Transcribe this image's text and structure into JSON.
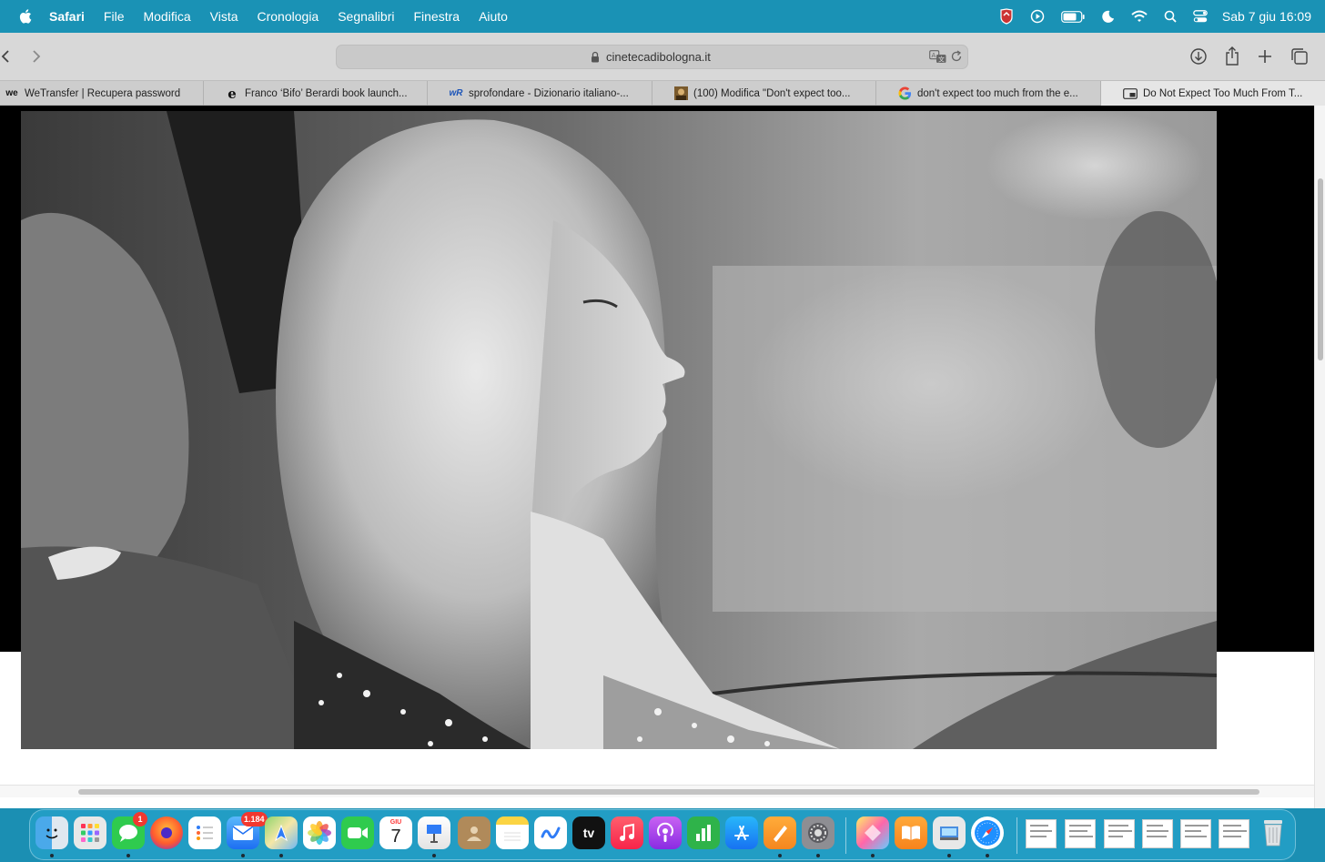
{
  "menubar": {
    "apple_icon": "apple-logo-icon",
    "items": [
      "Safari",
      "File",
      "Modifica",
      "Vista",
      "Cronologia",
      "Segnalibri",
      "Finestra",
      "Aiuto"
    ],
    "status_icons": [
      "vpn-shield-icon",
      "play-circle-icon",
      "battery-icon",
      "moon-icon",
      "wifi-icon",
      "search-icon",
      "control-center-icon"
    ],
    "clock": "Sab 7 giu  16:09"
  },
  "toolbar": {
    "url": "cinetecadibologna.it"
  },
  "tabs": [
    {
      "fav_text": "we",
      "label": "WeTransfer | Recupera password"
    },
    {
      "fav_text": "e",
      "label": "Franco ‘Bifo’ Berardi book launch..."
    },
    {
      "fav_text": "wR",
      "label": "sprofondare - Dizionario italiano-..."
    },
    {
      "fav_text": "",
      "label": "(100) Modifica \"Don't expect too..."
    },
    {
      "fav_text": "G",
      "label": "don't expect too much from the e..."
    },
    {
      "fav_text": "",
      "label": "Do Not Expect Too Much From T..."
    }
  ],
  "dock": {
    "messages_badge": "1",
    "mail_badge": "1.184",
    "calendar_month": "GIU",
    "calendar_day": "7",
    "tv_label": "tv"
  },
  "colors": {
    "menubar": "#1a92b5",
    "dock": "#28aad2",
    "toolbar": "#d8d8d8"
  }
}
